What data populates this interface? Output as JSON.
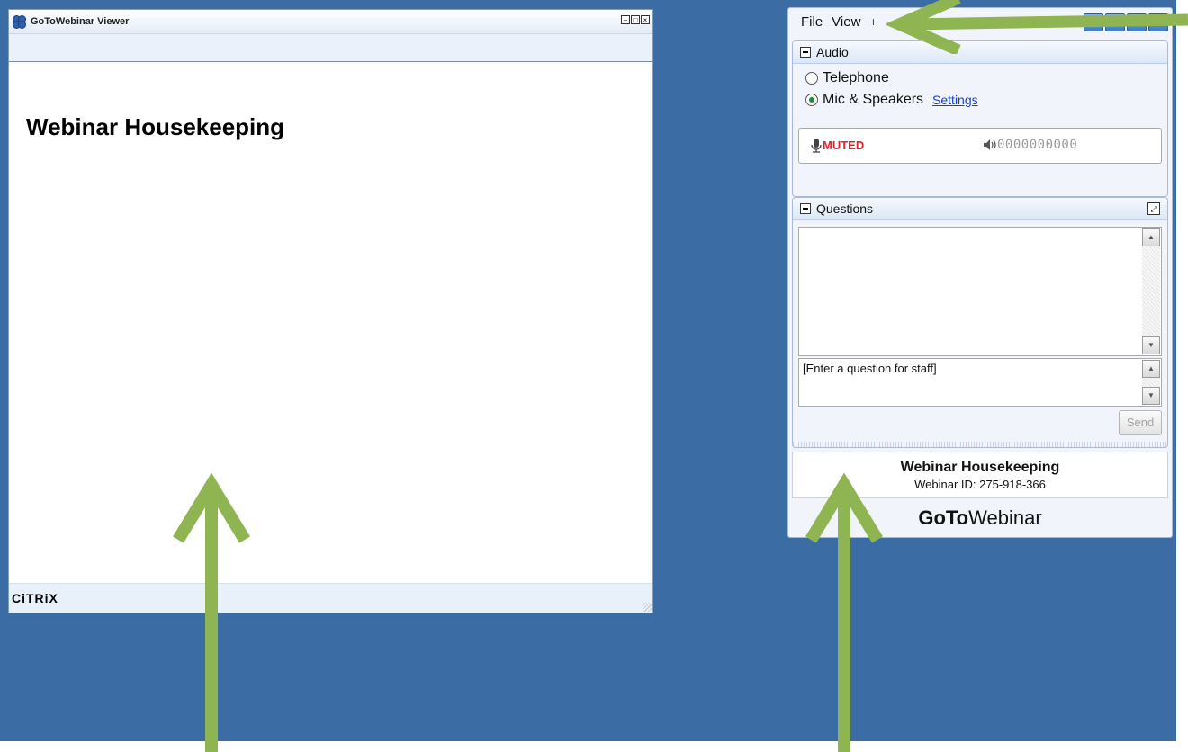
{
  "viewer": {
    "title": "GoToWebinar Viewer",
    "slide_heading": "Webinar Housekeeping",
    "footer_logo": "CiTRiX"
  },
  "panel": {
    "menu": [
      "File",
      "View",
      "+"
    ],
    "audio": {
      "header": "Audio",
      "option_telephone": "Telephone",
      "option_mic": "Mic & Speakers",
      "settings_link": "Settings",
      "status": "MUTED",
      "level_meter": "0000000000",
      "selected": "Mic & Speakers"
    },
    "questions": {
      "header": "Questions",
      "input_placeholder": "[Enter a question for staff]",
      "send_label": "Send"
    },
    "info": {
      "title": "Webinar Housekeeping",
      "webinar_id": "Webinar ID: 275-918-366"
    },
    "brand_bold": "GoTo",
    "brand_light": "Webinar"
  },
  "colors": {
    "desktop_bg": "#3b6ca3",
    "annotation_arrow": "#8fb553",
    "muted_text": "#e4222e",
    "link": "#1a3fd0"
  }
}
